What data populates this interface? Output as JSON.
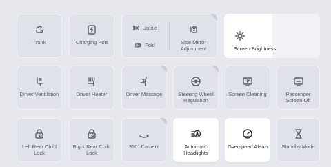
{
  "rows": [
    [
      {
        "id": "trunk",
        "label": "Trunk",
        "icon": "trunk-icon",
        "active": false,
        "corner": false
      },
      {
        "id": "charging-port",
        "label": "Charging Port",
        "icon": "charging-port-icon",
        "active": false,
        "corner": false
      }
    ],
    [
      {
        "id": "driver-ventilation",
        "label": "Driver Ventilation",
        "icon": "seat-ventilation-icon",
        "active": false,
        "corner": false
      },
      {
        "id": "driver-heater",
        "label": "Driver Heater",
        "icon": "seat-heater-icon",
        "active": false,
        "corner": false
      },
      {
        "id": "driver-massage",
        "label": "Driver Massage",
        "icon": "seat-massage-icon",
        "active": false,
        "corner": true
      },
      {
        "id": "steering-wheel-regulation",
        "label": "Steering Wheel Regulation",
        "icon": "steering-wheel-icon",
        "active": false,
        "corner": true
      },
      {
        "id": "screen-cleaning",
        "label": "Screen Cleaning",
        "icon": "screen-cleaning-icon",
        "active": false,
        "corner": false
      },
      {
        "id": "passenger-screen-off",
        "label": "Passenger Screen Off",
        "icon": "screen-off-icon",
        "active": false,
        "corner": false
      }
    ],
    [
      {
        "id": "left-rear-child-lock",
        "label": "Left Rear Child Lock",
        "icon": "child-lock-icon",
        "active": false,
        "corner": false
      },
      {
        "id": "right-rear-child-lock",
        "label": "Right Rear Child Lock",
        "icon": "child-lock-icon",
        "active": false,
        "corner": false
      },
      {
        "id": "camera-360",
        "label": "360° Camera",
        "icon": "camera-360-icon",
        "active": false,
        "corner": true
      },
      {
        "id": "automatic-headlights",
        "label": "Automatic Headlights",
        "icon": "auto-headlights-icon",
        "active": true,
        "corner": false
      },
      {
        "id": "overspeed-alarm",
        "label": "Overspeed Alarm",
        "icon": "speedometer-icon",
        "active": true,
        "corner": false
      },
      {
        "id": "standby-mode",
        "label": "Standby Mode",
        "icon": "hourglass-icon",
        "active": false,
        "corner": false
      }
    ]
  ],
  "mirror": {
    "unfold_label": "Unfold",
    "fold_label": "Fold",
    "adjust_label": "Side Mirror Adjustment"
  },
  "brightness": {
    "label": "Screen Brightness",
    "level": 0.5
  },
  "colors": {
    "background": "#e6e8ed",
    "tile": "#dfe2e8",
    "active": "#ffffff",
    "text": "#5b626d"
  }
}
